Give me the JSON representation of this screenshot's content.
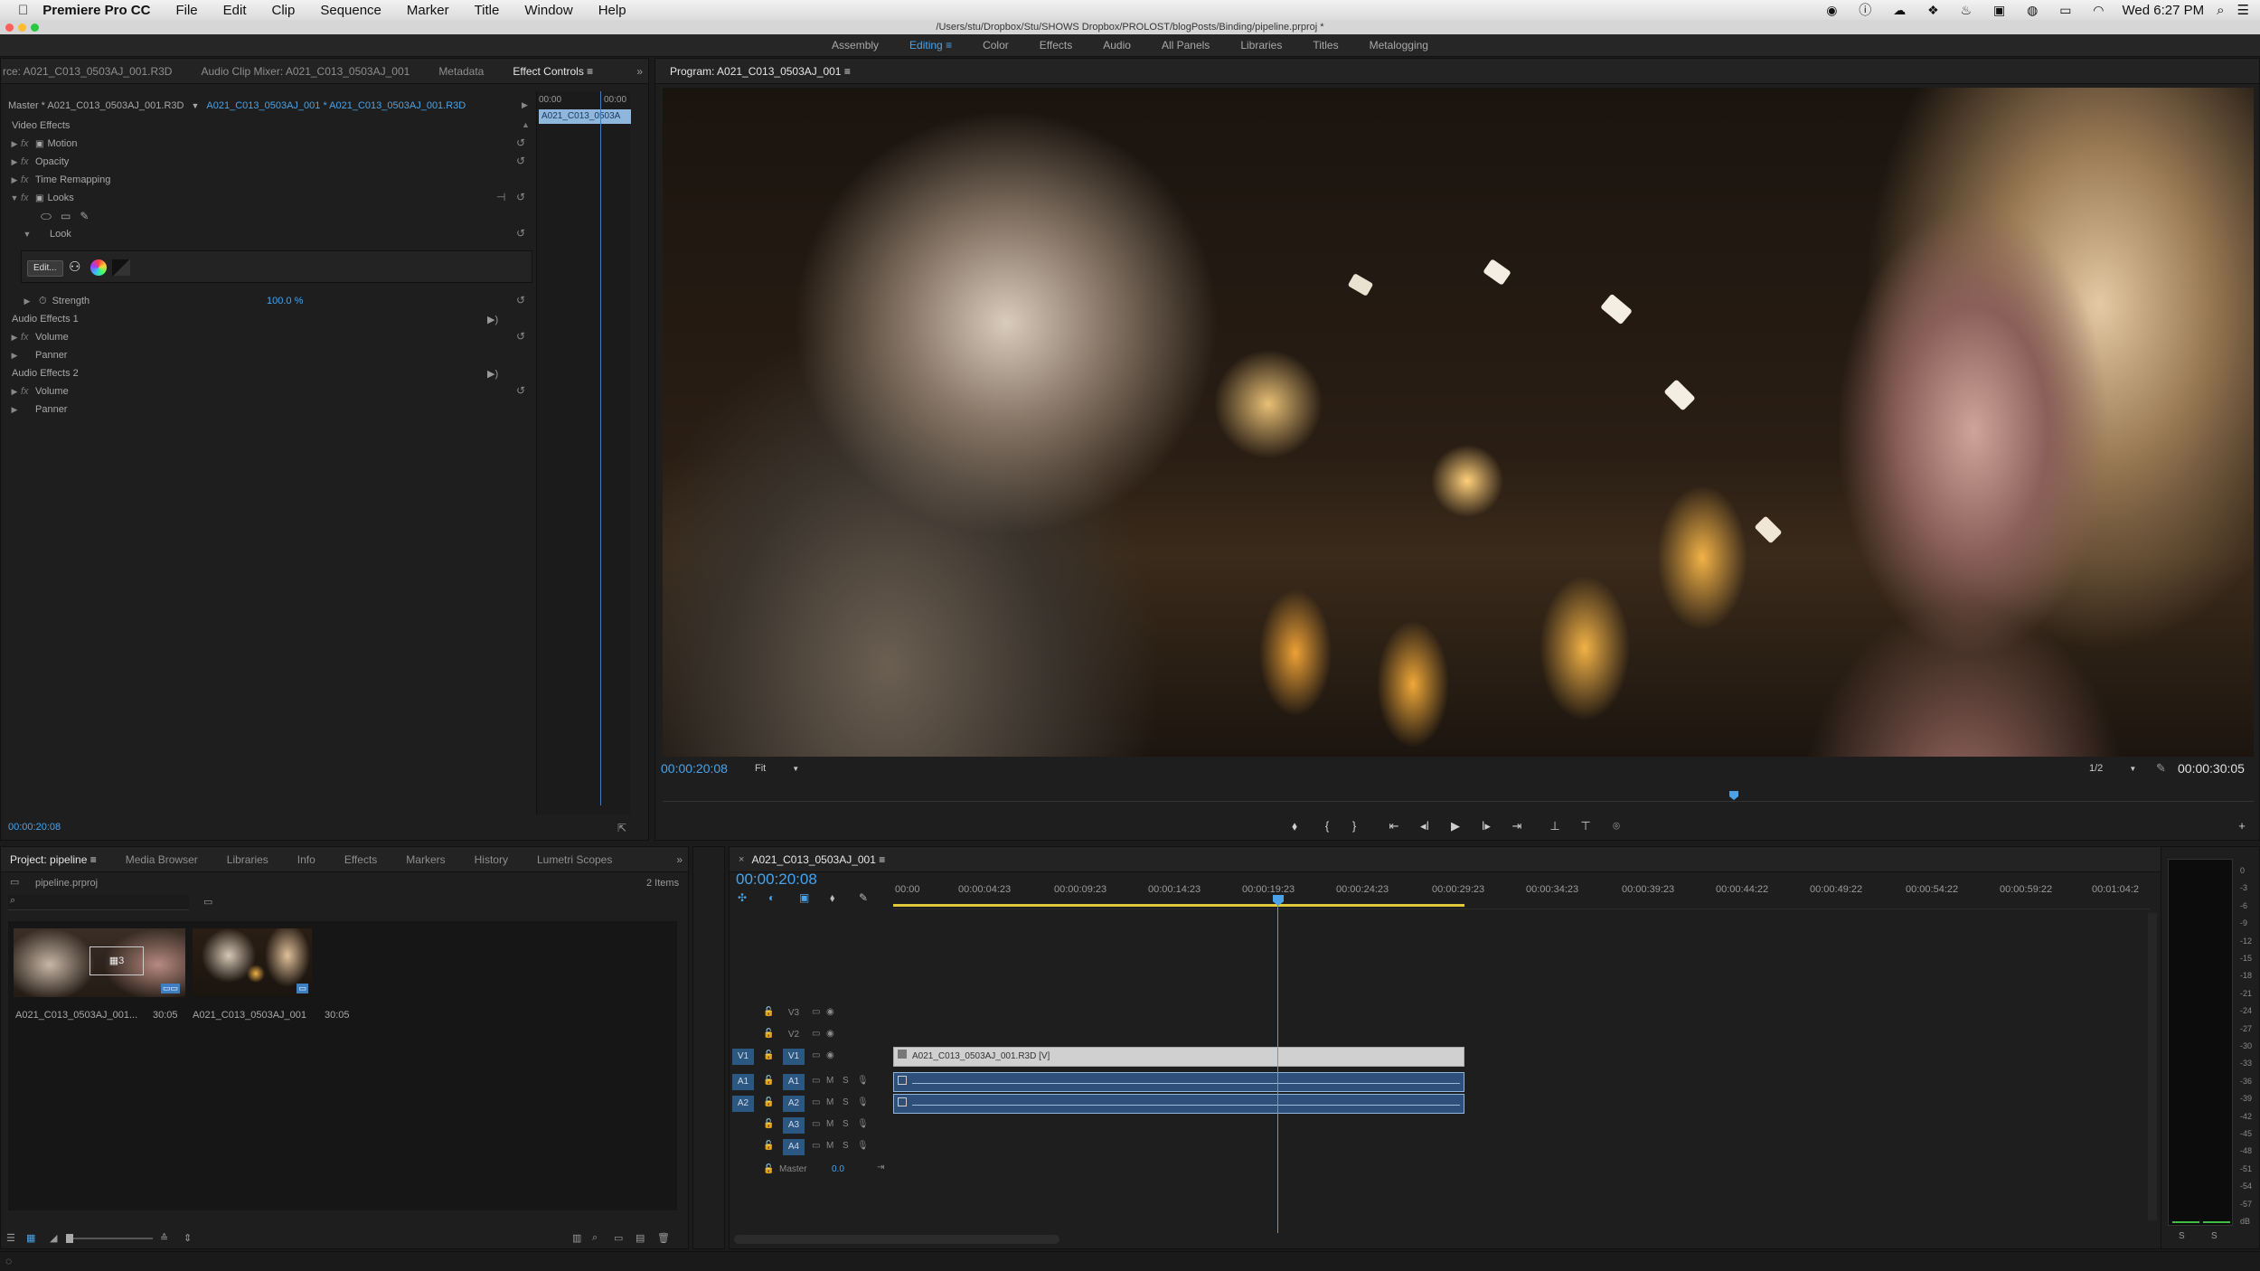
{
  "menubar": {
    "app": "Premiere Pro CC",
    "items": [
      "File",
      "Edit",
      "Clip",
      "Sequence",
      "Marker",
      "Title",
      "Window",
      "Help"
    ],
    "clock": "Wed 6:27 PM"
  },
  "titlebar": {
    "path": "/Users/stu/Dropbox/Stu/SHOWS Dropbox/PROLOST/blogPosts/Binding/pipeline.prproj *"
  },
  "workspaces": [
    "Assembly",
    "Editing",
    "Color",
    "Effects",
    "Audio",
    "All Panels",
    "Libraries",
    "Titles",
    "Metalogging"
  ],
  "source_panel": {
    "tabs": [
      "rce: A021_C013_0503AJ_001.R3D",
      "Audio Clip Mixer: A021_C013_0503AJ_001",
      "Metadata",
      "Effect Controls"
    ],
    "master_label": "Master * A021_C013_0503AJ_001.R3D",
    "clip_label": "A021_C013_0503AJ_001 * A021_C013_0503AJ_001.R3D",
    "mini_ruler": [
      "00:00",
      "00:00"
    ],
    "mini_clip": "A021_C013_0503A",
    "video_effects": "Video Effects",
    "motion": "Motion",
    "opacity": "Opacity",
    "time_remap": "Time Remapping",
    "looks": "Looks",
    "look": "Look",
    "edit_btn": "Edit...",
    "strength": "Strength",
    "strength_val": "100.0 %",
    "audio_fx1": "Audio Effects 1",
    "volume1": "Volume",
    "panner1": "Panner",
    "audio_fx2": "Audio Effects 2",
    "volume2": "Volume",
    "panner2": "Panner",
    "timecode": "00:00:20:08"
  },
  "program": {
    "title": "Program: A021_C013_0503AJ_001",
    "timecode": "00:00:20:08",
    "fit": "Fit",
    "resolution": "1/2",
    "duration": "00:00:30:05"
  },
  "project": {
    "tabs": [
      "Project: pipeline",
      "Media Browser",
      "Libraries",
      "Info",
      "Effects",
      "Markers",
      "History",
      "Lumetri Scopes"
    ],
    "file": "pipeline.prproj",
    "count": "2 Items",
    "items": [
      {
        "name": "A021_C013_0503AJ_001...",
        "dur": "30:05"
      },
      {
        "name": "A021_C013_0503AJ_001",
        "dur": "30:05"
      }
    ]
  },
  "timeline": {
    "tab": "A021_C013_0503AJ_001",
    "timecode": "00:00:20:08",
    "ruler": [
      "00:00",
      "00:00:04:23",
      "00:00:09:23",
      "00:00:14:23",
      "00:00:19:23",
      "00:00:24:23",
      "00:00:29:23",
      "00:00:34:23",
      "00:00:39:23",
      "00:00:44:22",
      "00:00:49:22",
      "00:00:54:22",
      "00:00:59:22",
      "00:01:04:2"
    ],
    "tracks": {
      "v3": "V3",
      "v2": "V2",
      "v1": "V1",
      "a1": "A1",
      "a2": "A2",
      "a3": "A3",
      "a4": "A4"
    },
    "clip_name": "A021_C013_0503AJ_001.R3D [V]",
    "master": "Master",
    "master_val": "0.0",
    "meter_scale": [
      "0",
      "-3",
      "-6",
      "-9",
      "-12",
      "-15",
      "-18",
      "-21",
      "-24",
      "-27",
      "-30",
      "-33",
      "-36",
      "-39",
      "-42",
      "-45",
      "-48",
      "-51",
      "-54",
      "-57",
      "dB"
    ],
    "meter_solo": [
      "S",
      "S"
    ]
  }
}
